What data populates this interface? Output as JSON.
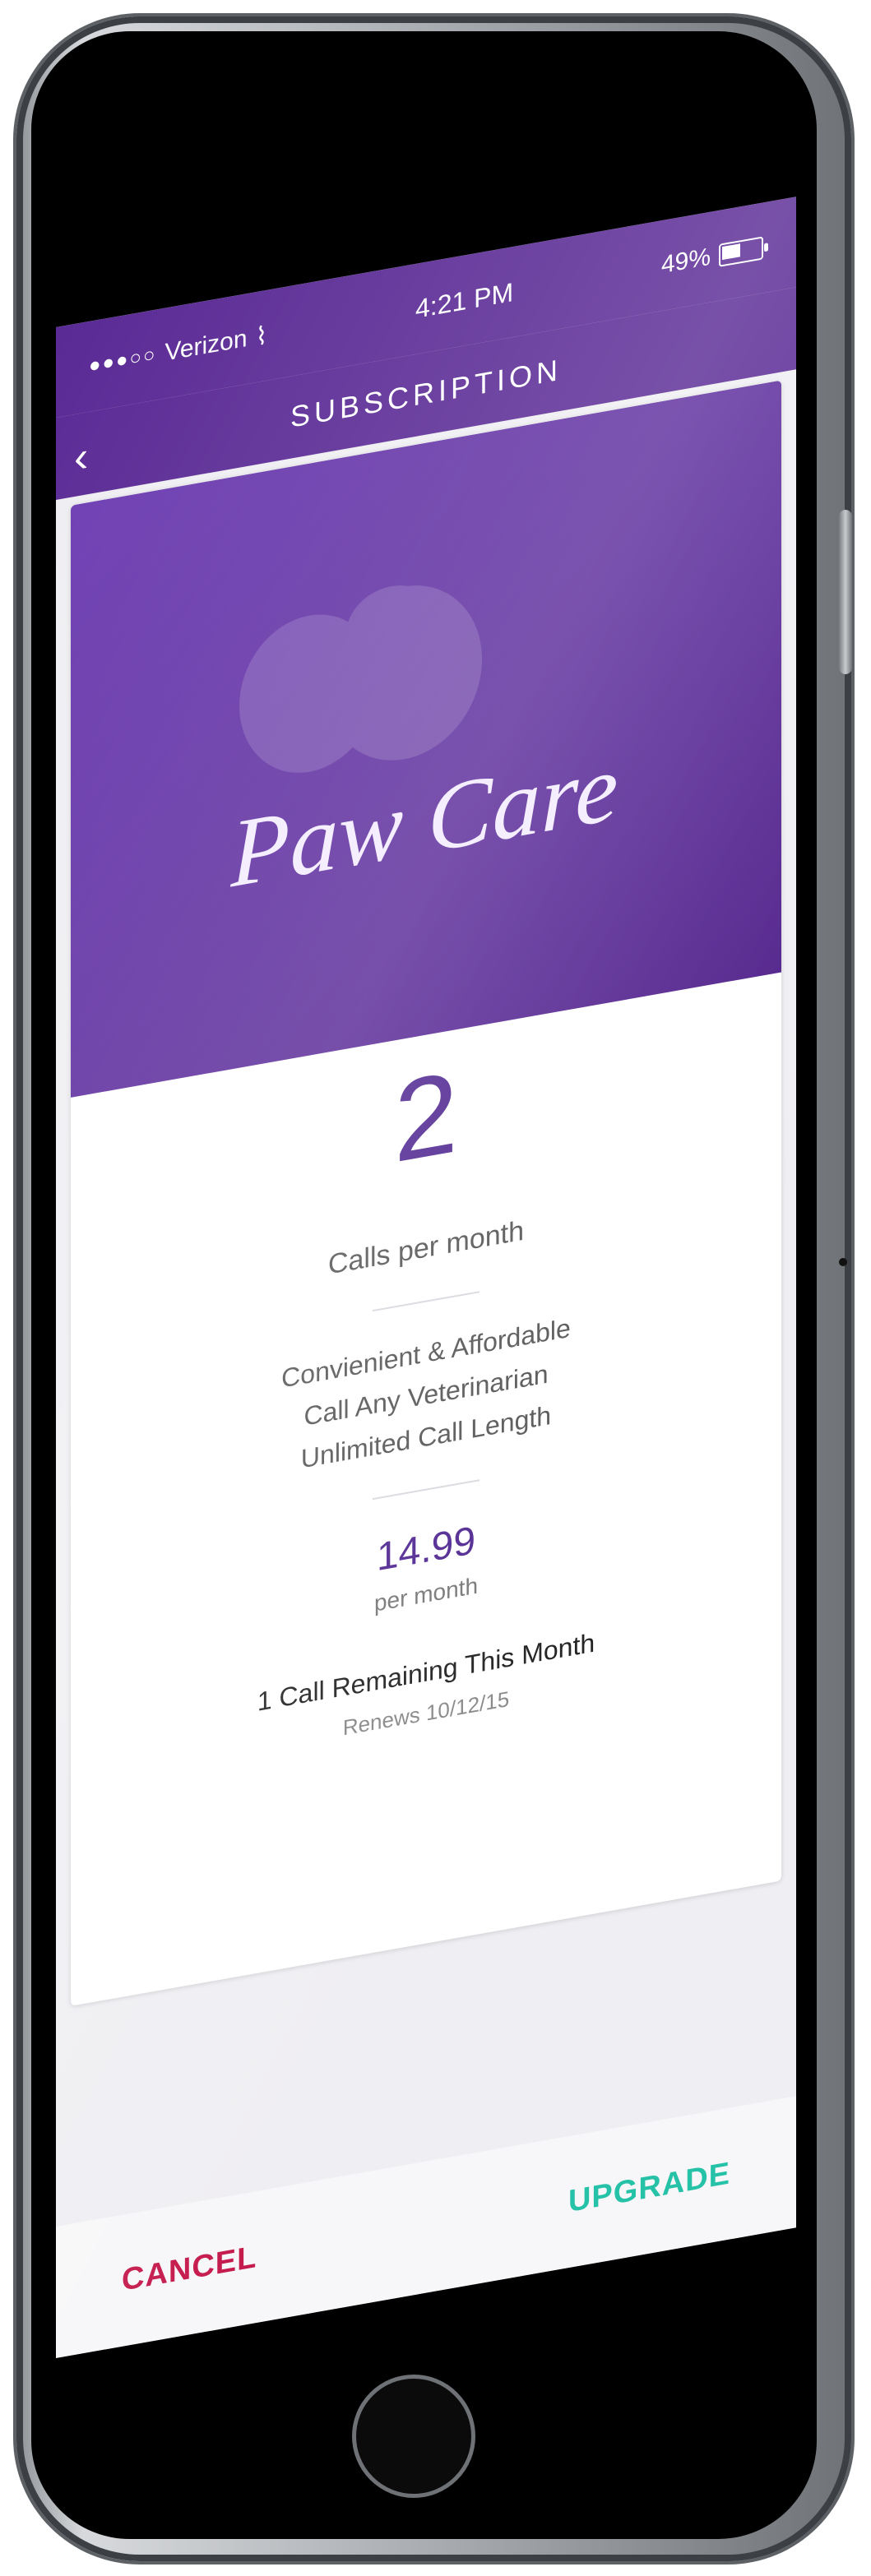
{
  "status": {
    "carrier": "Verizon",
    "time": "4:21 PM",
    "battery": "49%"
  },
  "nav": {
    "title": "SUBSCRIPTION"
  },
  "plan": {
    "name": "Paw Care",
    "calls_value": "2",
    "calls_label": "Calls per month",
    "features": [
      "Convienient & Affordable",
      "Call Any Veterinarian",
      "Unlimited Call Length"
    ],
    "price": "14.99",
    "price_period": "per month",
    "remaining": "1 Call Remaining This Month",
    "renews": "Renews 10/12/15"
  },
  "actions": {
    "cancel": "CANCEL",
    "upgrade": "UPGRADE"
  },
  "colors": {
    "primary": "#5a2a95",
    "cancel": "#c4184b",
    "upgrade": "#25c2a7"
  }
}
